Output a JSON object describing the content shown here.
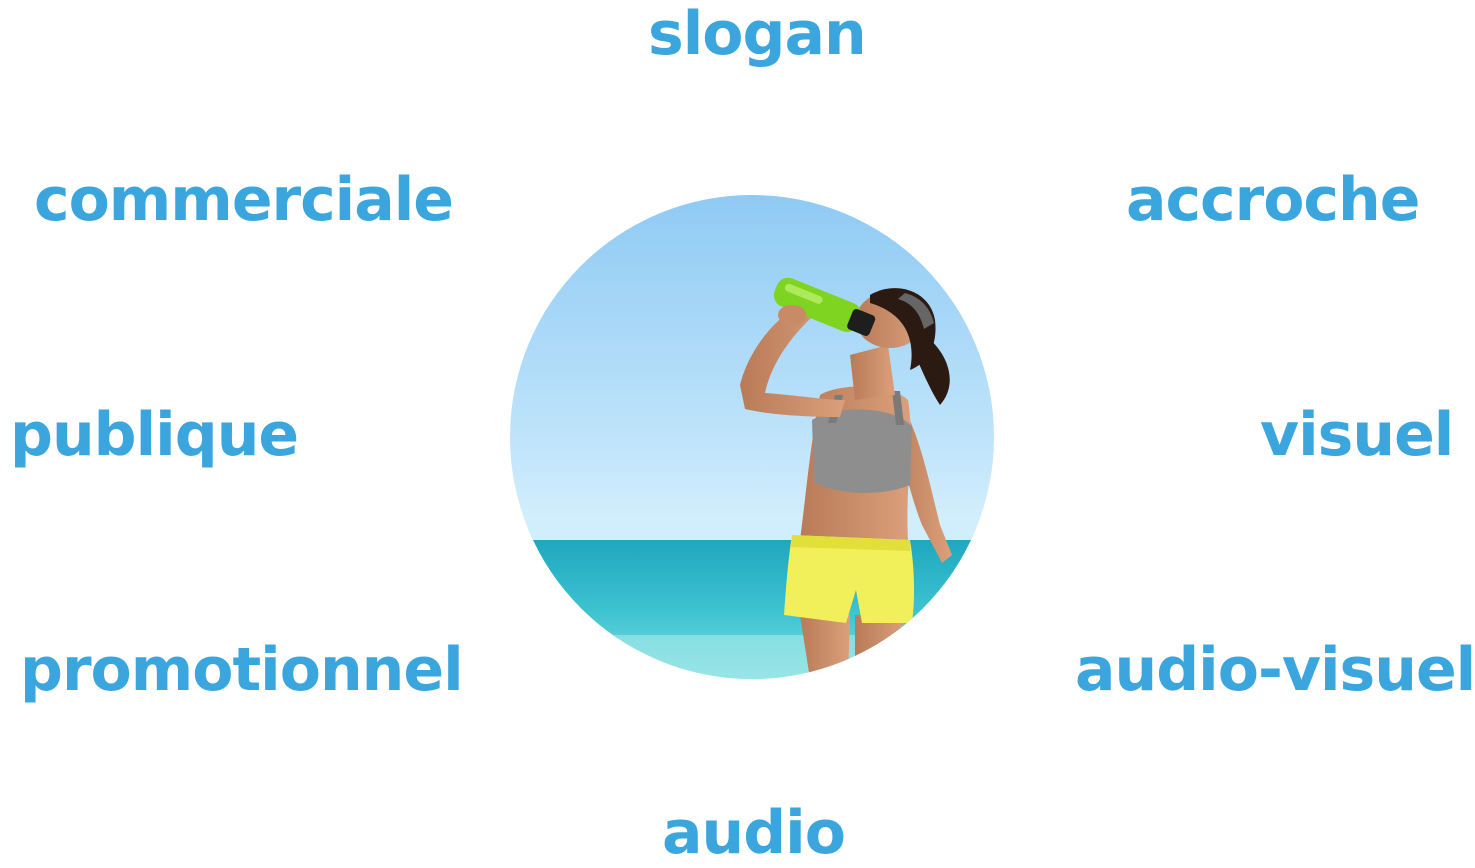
{
  "words": {
    "slogan": "slogan",
    "commerciale": "commerciale",
    "accroche": "accroche",
    "publique": "publique",
    "visuel": "visuel",
    "promotionnel": "promotionnel",
    "audio_visuel": "audio-visuel",
    "audio": "audio"
  },
  "colors": {
    "word_color": "#3aa6dd",
    "sky_top": "#8fcaf3",
    "sky_bottom": "#bfe4fb",
    "sea": "#2bb6c6",
    "top": "#8e8e8e",
    "shorts": "#f1f05a",
    "bottle": "#7fd321"
  },
  "photo": {
    "subject": "woman drinking from a sports bottle at the beach"
  }
}
